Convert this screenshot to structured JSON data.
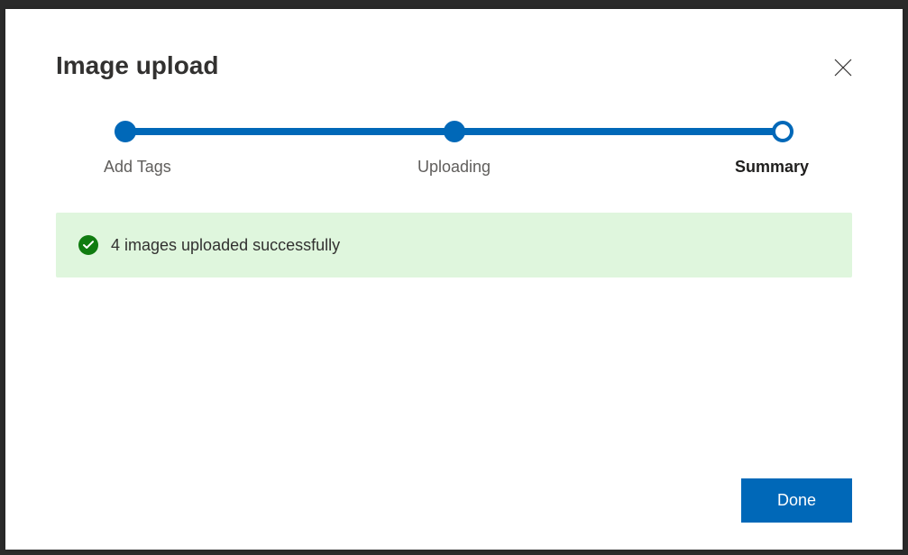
{
  "header": {
    "title": "Image upload"
  },
  "stepper": {
    "steps": [
      {
        "label": "Add Tags",
        "state": "done"
      },
      {
        "label": "Uploading",
        "state": "done"
      },
      {
        "label": "Summary",
        "state": "current"
      }
    ]
  },
  "status": {
    "message": "4 images uploaded successfully",
    "type": "success"
  },
  "footer": {
    "done_label": "Done"
  }
}
